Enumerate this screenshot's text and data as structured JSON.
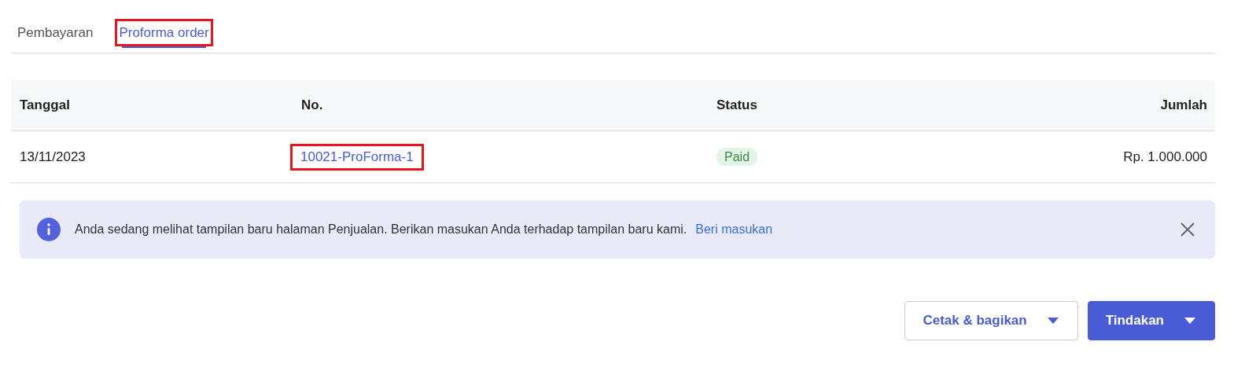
{
  "tabs": [
    {
      "label": "Pembayaran",
      "selected": false,
      "highlighted": false
    },
    {
      "label": "Proforma order",
      "selected": true,
      "highlighted": true
    }
  ],
  "table": {
    "columns": [
      "Tanggal",
      "No.",
      "Status",
      "Jumlah"
    ],
    "rows": [
      {
        "date": "13/11/2023",
        "number": "10021-ProForma-1",
        "number_highlighted": true,
        "status": "Paid",
        "amount": "Rp. 1.000.000"
      }
    ]
  },
  "notice": {
    "text": "Anda sedang melihat tampilan baru halaman Penjualan. Berikan masukan Anda terhadap tampilan baru kami.",
    "link": "Beri masukan"
  },
  "buttons": [
    {
      "label": "Cetak & bagikan",
      "kind": "secondary"
    },
    {
      "label": "Tindakan",
      "kind": "primary"
    }
  ]
}
